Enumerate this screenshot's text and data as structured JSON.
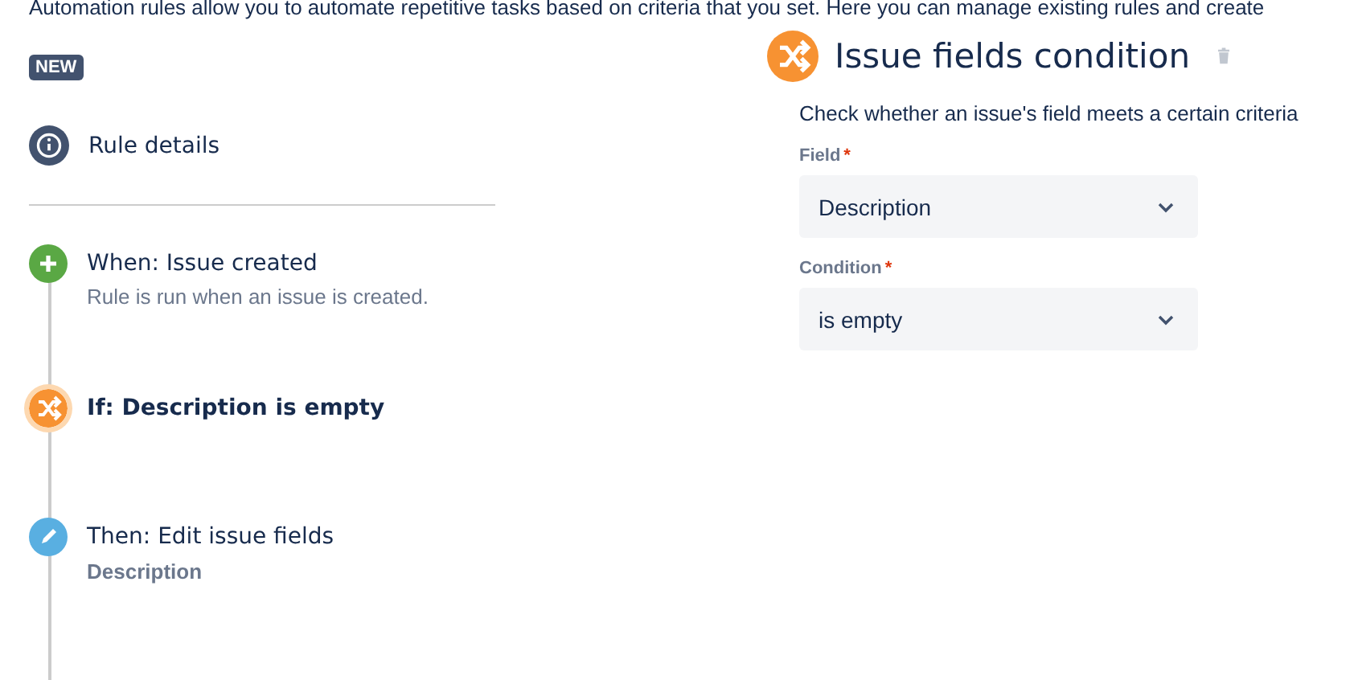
{
  "intro": "Automation rules allow you to automate repetitive tasks based on criteria that you set. Here you can manage existing rules and create",
  "badge": "NEW",
  "rule_details": {
    "label": "Rule details"
  },
  "steps": [
    {
      "kind": "trigger",
      "title": "When: Issue created",
      "subtitle": "Rule is run when an issue is created.",
      "selected": false
    },
    {
      "kind": "condition",
      "title": "If: Description is empty",
      "selected": true
    },
    {
      "kind": "action",
      "title": "Then: Edit issue fields",
      "detail": "Description",
      "selected": false
    }
  ],
  "panel": {
    "title": "Issue fields condition",
    "description": "Check whether an issue's field meets a certain criteria",
    "fields": [
      {
        "label": "Field",
        "required_mark": "*",
        "value": "Description"
      },
      {
        "label": "Condition",
        "required_mark": "*",
        "value": "is empty"
      }
    ]
  }
}
